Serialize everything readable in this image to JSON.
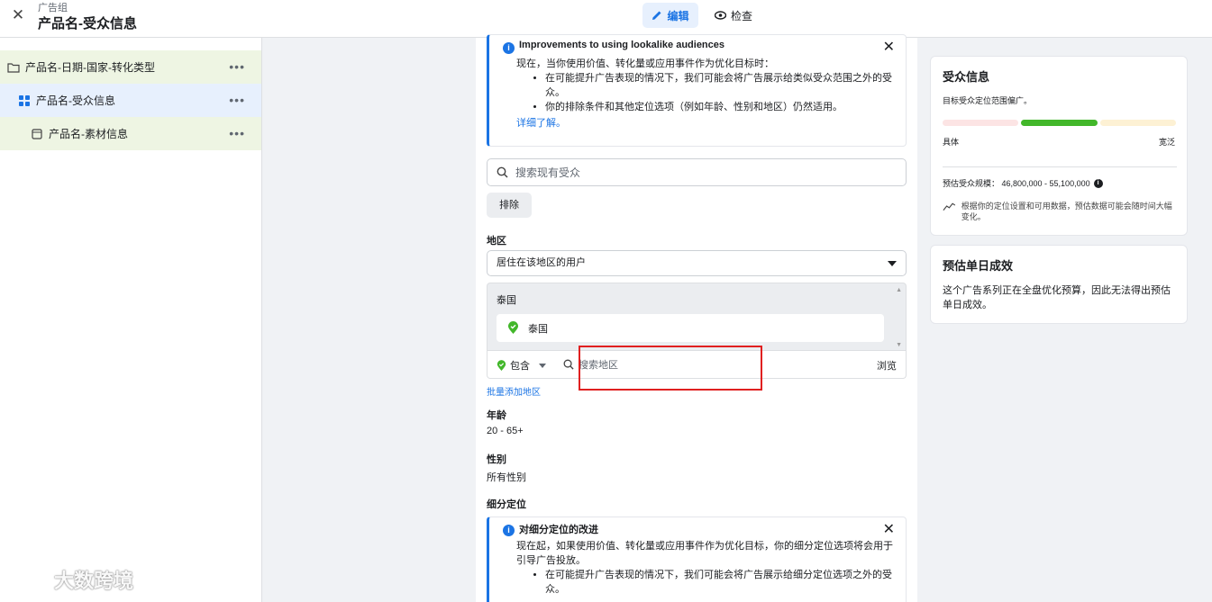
{
  "header": {
    "close_icon": "close-icon",
    "crumb_small": "广告组",
    "title": "产品名-受众信息",
    "mode_edit": "编辑",
    "mode_review": "检查"
  },
  "sidebar": {
    "items": [
      {
        "label": "产品名-日期-国家-转化类型",
        "icon": "folder-icon",
        "more": "•••"
      },
      {
        "label": "产品名-受众信息",
        "icon": "grid-icon",
        "more": "•••"
      },
      {
        "label": "产品名-素材信息",
        "icon": "ad-icon",
        "more": "•••"
      }
    ]
  },
  "main": {
    "notice1": {
      "title": "Improvements to using lookalike audiences",
      "lead": "现在，当你使用价值、转化量或应用事件作为优化目标时：",
      "bullets": [
        "在可能提升广告表现的情况下，我们可能会将广告展示给类似受众范围之外的受众。",
        "你的排除条件和其他定位选项（例如年龄、性别和地区）仍然适用。"
      ],
      "link": "详细了解。"
    },
    "search_audience_placeholder": "搜索现有受众",
    "exclude_label": "排除",
    "location": {
      "label": "地区",
      "select_value": "居住在该地区的用户",
      "country_header": "泰国",
      "chip": "泰国",
      "include_label": "包含",
      "search_placeholder": "搜索地区",
      "browse": "浏览",
      "bulk_link": "批量添加地区"
    },
    "age": {
      "label": "年龄",
      "value": "20 - 65+"
    },
    "gender": {
      "label": "性别",
      "value": "所有性别"
    },
    "detailed": {
      "label": "细分定位"
    },
    "notice2": {
      "title": "对细分定位的改进",
      "lead": "现在起，如果使用价值、转化量或应用事件作为优化目标，你的细分定位选项将会用于引导广告投放。",
      "bullets": [
        "在可能提升广告表现的情况下，我们可能会将广告展示给细分定位选项之外的受众。"
      ]
    }
  },
  "right": {
    "audience": {
      "title": "受众信息",
      "desc": "目标受众定位范围偏广。",
      "specific": "具体",
      "broad": "宽泛",
      "size": "预估受众规模： 46,800,000 - 55,100,000",
      "note": "根据你的定位设置和可用数据，预估数据可能会随时间大幅变化。",
      "meter_level": "broad-middle"
    },
    "daily": {
      "title": "预估单日成效",
      "body": "这个广告系列正在全盘优化预算，因此无法得出预估单日成效。"
    }
  },
  "watermark": "大数跨境",
  "colors": {
    "accent": "#1b74e4",
    "highlight": "#e02020",
    "meter_mid": "#42b72a"
  }
}
